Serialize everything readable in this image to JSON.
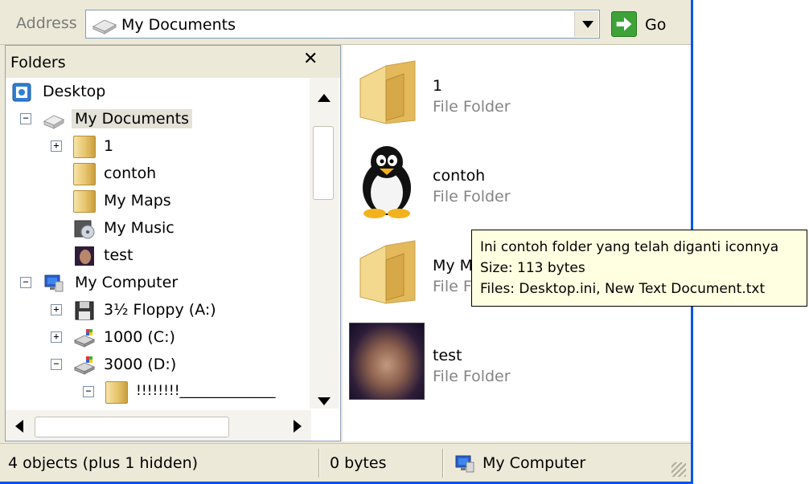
{
  "address_bar": {
    "label": "Address",
    "value": "My Documents",
    "go_label": "Go"
  },
  "folders_pane": {
    "title": "Folders",
    "tree": [
      {
        "label": "Desktop",
        "icon": "desktop-icon",
        "level": 0,
        "expander": "none"
      },
      {
        "label": "My Documents",
        "icon": "my-documents-icon",
        "level": 1,
        "expander": "minus",
        "selected": true
      },
      {
        "label": "1",
        "icon": "folder-icon",
        "level": 2,
        "expander": "plus"
      },
      {
        "label": "contoh",
        "icon": "folder-icon",
        "level": 2,
        "expander": "none"
      },
      {
        "label": "My Maps",
        "icon": "folder-icon",
        "level": 2,
        "expander": "none"
      },
      {
        "label": "My Music",
        "icon": "music-folder-icon",
        "level": 2,
        "expander": "none"
      },
      {
        "label": "test",
        "icon": "photo-icon",
        "level": 2,
        "expander": "none"
      },
      {
        "label": "My Computer",
        "icon": "computer-icon",
        "level": 1,
        "expander": "minus"
      },
      {
        "label": "3½ Floppy (A:)",
        "icon": "floppy-icon",
        "level": 2,
        "expander": "plus"
      },
      {
        "label": "1000 (C:)",
        "icon": "drive-icon",
        "level": 2,
        "expander": "plus"
      },
      {
        "label": "3000 (D:)",
        "icon": "drive-icon",
        "level": 2,
        "expander": "minus"
      },
      {
        "label": "!!!!!!!!______________",
        "icon": "folder-icon",
        "level": 3,
        "expander": "minus"
      }
    ]
  },
  "content": {
    "items": [
      {
        "name": "1",
        "type": "File Folder",
        "thumbnail": "folder-icon"
      },
      {
        "name": "contoh",
        "type": "File Folder",
        "thumbnail": "penguin-icon"
      },
      {
        "name": "My M",
        "type": "File F",
        "thumbnail": "folder-icon"
      },
      {
        "name": "test",
        "type": "File Folder",
        "thumbnail": "photo-thumbnail"
      }
    ]
  },
  "tooltip": {
    "line1": "Ini contoh folder yang telah diganti iconnya",
    "line2": "Size: 113 bytes",
    "line3": "Files: Desktop.ini, New Text Document.txt"
  },
  "status_bar": {
    "objects": "4 objects (plus 1 hidden)",
    "size": "0 bytes",
    "location": "My Computer"
  },
  "colors": {
    "window_bg": "#ece9d8",
    "border_blue": "#0055ea",
    "tooltip_bg": "#ffffe1",
    "go_green": "#3da338",
    "muted_text": "#848484"
  }
}
